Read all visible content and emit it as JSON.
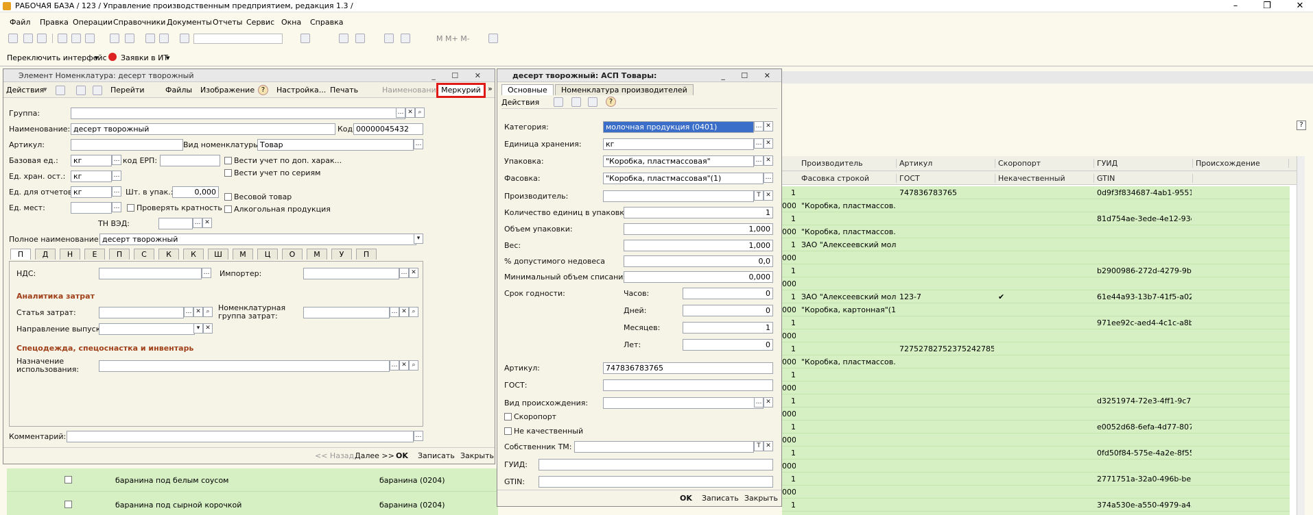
{
  "app": {
    "title": "РАБОЧАЯ БАЗА / 123 /  Управление производственным предприятием, редакция 1.3 /"
  },
  "menu": [
    "Файл",
    "Правка",
    "Операции",
    "Справочники",
    "Документы",
    "Отчеты",
    "Сервис",
    "Окна",
    "Справка"
  ],
  "toolbar2": {
    "switch_label": "Переключить интерфейс",
    "requests_label": "Заявки в ИТ"
  },
  "left": {
    "title": "Элемент Номенклатура: десерт творожный",
    "actions": [
      "Действия",
      "Перейти",
      "Файлы",
      "Изображение",
      "Настройка...",
      "Печать",
      "Наименование",
      "Меркурий"
    ],
    "labels": {
      "group": "Группа:",
      "name": "Наименование:",
      "code": "Код:",
      "article": "Артикул:",
      "type": "Вид номенклатуры:",
      "base": "Базовая ед.:",
      "erp": "код ЕРП:",
      "storage": "Ед. хран. ост.:",
      "reports": "Ед. для отчетов:",
      "per_pack": "Шт. в упак.:",
      "places": "Ед. мест:",
      "tnved": "ТН ВЭД:",
      "fullname": "Полное наименование:",
      "vat": "НДС:",
      "importer": "Импортер:",
      "expense_item": "Статья затрат:",
      "nom_group": "Номенклатурная группа затрат:",
      "direction": "Направление выпуска:",
      "purpose": "Назначение использования:",
      "comment": "Комментарий:"
    },
    "values": {
      "name": "десерт творожный",
      "code": "00000045432",
      "type": "Товар",
      "base": "кг",
      "storage": "кг",
      "reports": "кг",
      "per_pack": "0,000",
      "fullname": "десерт творожный"
    },
    "checks": [
      "Вести учет по доп.  харак...",
      "Вести учет по сериям",
      "Весовой товар",
      "Алкогольная продукция",
      "Проверять кратность"
    ],
    "tabs": [
      "П",
      "Д",
      "Н",
      "Е",
      "П",
      "С",
      "К",
      "К",
      "Ш",
      "М",
      "Ц",
      "О",
      "М",
      "У",
      "П"
    ],
    "sections": [
      "Аналитика затрат",
      "Спецодежда, спецоснастка и инвентарь"
    ],
    "footer": [
      "<< Назад",
      "Далее >>",
      "OK",
      "Записать",
      "Закрыть"
    ]
  },
  "right": {
    "title": "десерт творожный: АСП Товары:",
    "tabs": [
      "Основные",
      "Номенклатура производителей"
    ],
    "actions_label": "Действия",
    "labels": {
      "category": "Категория:",
      "storage_unit": "Единица хранения:",
      "package": "Упаковка:",
      "packing": "Фасовка:",
      "producer": "Производитель:",
      "qty": "Количество единиц в упаковке:",
      "vol": "Объем упаковки:",
      "weight": "Вес:",
      "shortage": "% допустимого недовеса",
      "minvol": "Минимальный объем списания:",
      "shelf": "Срок годности:",
      "hours": "Часов:",
      "days": "Дней:",
      "months": "Месяцев:",
      "years": "Лет:",
      "article": "Артикул:",
      "gost": "ГОСТ:",
      "origin": "Вид происхождения:",
      "perishable": "Скоропорт",
      "nonquality": "Не качественный",
      "owner": "Собственник ТМ:",
      "guid": "ГУИД:",
      "gtin": "GTIN:"
    },
    "values": {
      "category": "молочная продукция (0401)",
      "storage_unit": "кг",
      "package": "\"Коробка, пластмассовая\"",
      "packing": "\"Коробка, пластмассовая\"(1)",
      "qty": "1",
      "vol": "1,000",
      "weight": "1,000",
      "shortage": "0,0",
      "minvol": "0,000",
      "hours": "0",
      "days": "0",
      "months": "1",
      "years": "0",
      "article": "747836783765"
    },
    "footer": [
      "OK",
      "Записать",
      "Закрыть"
    ]
  },
  "grid": {
    "headers": [
      "Производитель",
      "Артикул",
      "Скоропорт",
      "ГУИД",
      "Происхождение"
    ],
    "subheaders": [
      "Фасовка строкой",
      "ГОСТ",
      "Некачественный",
      "GTIN"
    ],
    "rows": [
      [
        "1",
        "",
        "747836783765",
        "",
        "0d9f3f834687-4ab1-9551f..."
      ],
      [
        "000",
        "\"Коробка, пластмассов...",
        "",
        "",
        ""
      ],
      [
        "1",
        "",
        "",
        "",
        "81d754ae-3ede-4e12-93e..."
      ],
      [
        "000",
        "\"Коробка, пластмассов...",
        "",
        "",
        ""
      ],
      [
        "1",
        "ЗАО \"Алексеевский мол...",
        "",
        "",
        ""
      ],
      [
        "000",
        "",
        "",
        "",
        ""
      ],
      [
        "1",
        "",
        "",
        "",
        "b2900986-272d-4279-9bc..."
      ],
      [
        "000",
        "",
        "",
        "",
        ""
      ],
      [
        "1",
        "ЗАО \"Алексеевский мол...",
        "123-7",
        "✔",
        "61e44a93-13b7-41f5-a024..."
      ],
      [
        "000",
        "\"Коробка, картонная\"(1)",
        "",
        "",
        ""
      ],
      [
        "1",
        "",
        "",
        "",
        "971ee92c-aed4-4c1c-a8b..."
      ],
      [
        "000",
        "",
        "",
        "",
        ""
      ],
      [
        "1",
        "",
        "727527827523752427852",
        "",
        ""
      ],
      [
        "000",
        "\"Коробка, пластмассов...",
        "",
        "",
        ""
      ],
      [
        "1",
        "",
        "",
        "",
        ""
      ],
      [
        "000",
        "",
        "",
        "",
        ""
      ],
      [
        "1",
        "",
        "",
        "",
        "d3251974-72e3-4ff1-9c7a-..."
      ],
      [
        "000",
        "",
        "",
        "",
        ""
      ],
      [
        "1",
        "",
        "",
        "",
        "e0052d68-6efa-4d77-8075..."
      ],
      [
        "000",
        "",
        "",
        "",
        ""
      ],
      [
        "1",
        "",
        "",
        "",
        "0fd50f84-575e-4a2e-8f55-..."
      ],
      [
        "000",
        "",
        "",
        "",
        ""
      ],
      [
        "1",
        "",
        "",
        "",
        "2771751a-32a0-496b-be7..."
      ],
      [
        "000",
        "",
        "",
        "",
        ""
      ],
      [
        "1",
        "",
        "",
        "",
        "374a530e-a550-4979-a45..."
      ]
    ],
    "bottom_rows": [
      [
        "баранина под белым соусом",
        "баранина (0204)"
      ],
      [
        "баранина под сырной корочкой",
        "баранина (0204)"
      ]
    ]
  }
}
